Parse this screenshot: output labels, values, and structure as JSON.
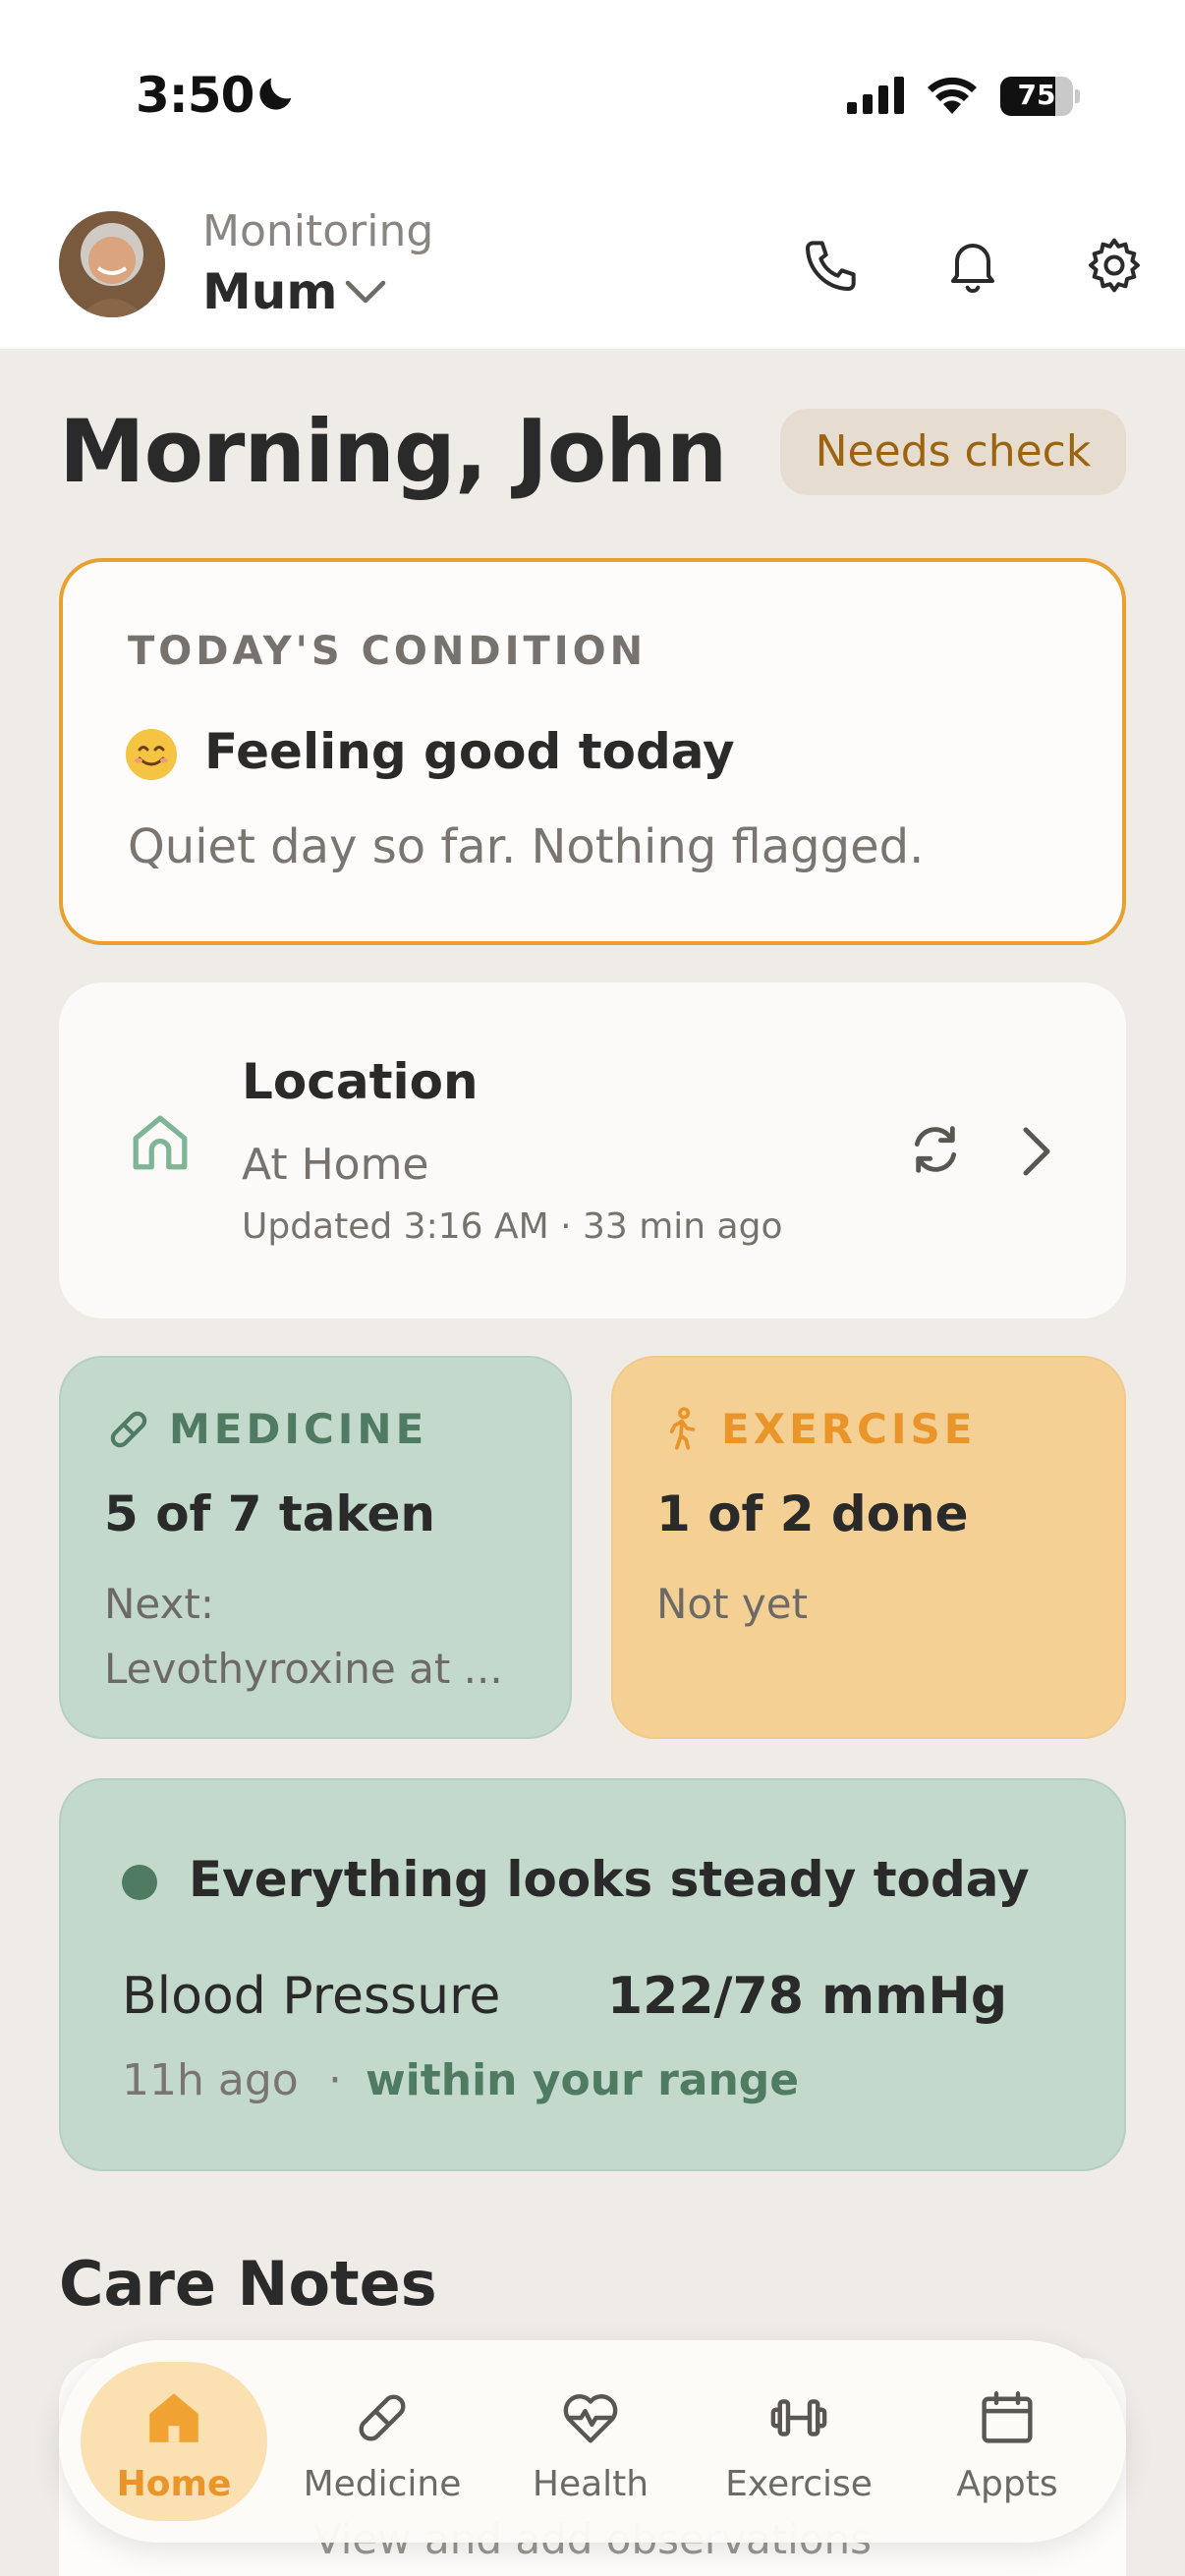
{
  "status_bar": {
    "time": "3:50",
    "battery": "75",
    "battery_level": 0.75
  },
  "header": {
    "monitoring_label": "Monitoring",
    "person_name": "Mum"
  },
  "greeting": "Morning, John",
  "status_badge": "Needs check",
  "condition": {
    "section_label": "TODAY'S CONDITION",
    "headline": "Feeling good today",
    "summary": "Quiet day so far. Nothing flagged."
  },
  "location": {
    "title": "Location",
    "status": "At Home",
    "updated": "Updated 3:16 AM · 33 min ago"
  },
  "medicine": {
    "label": "MEDICINE",
    "value": "5 of 7 taken",
    "next_label": "Next:",
    "next_value": "Levothyroxine at ..."
  },
  "exercise": {
    "label": "EXERCISE",
    "value": "1 of 2 done",
    "sub": "Not yet"
  },
  "vitals": {
    "headline": "Everything looks steady today",
    "metric_label": "Blood Pressure",
    "metric_value": "122/78 mmHg",
    "time_ago": "11h ago",
    "separator": "·",
    "range_note": "within your range"
  },
  "care_notes": {
    "title": "Care Notes",
    "hint": "View and add observations"
  },
  "tabs": [
    {
      "label": "Home",
      "icon": "home-icon",
      "active": true
    },
    {
      "label": "Medicine",
      "icon": "pill-icon",
      "active": false
    },
    {
      "label": "Health",
      "icon": "heart-pulse-icon",
      "active": false
    },
    {
      "label": "Exercise",
      "icon": "dumbbell-icon",
      "active": false
    },
    {
      "label": "Appts",
      "icon": "calendar-icon",
      "active": false
    }
  ],
  "colors": {
    "accent": "#eaa02e",
    "green": "#4e7b62",
    "medicine_bg": "#c2d9cb",
    "exercise_bg": "#f5d095"
  }
}
